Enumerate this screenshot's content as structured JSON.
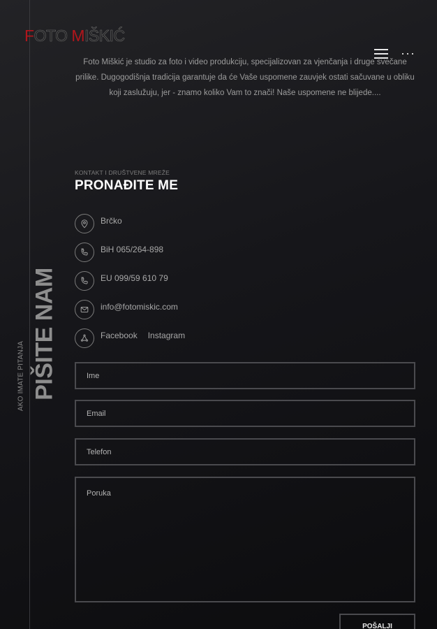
{
  "header": {
    "logo": {
      "part1_initial": "F",
      "part1_rest": "OTO",
      "part2_initial": "M",
      "part2_rest": "IŠKIĆ"
    },
    "menu_icon": "hamburger-icon",
    "more_icon": "ellipsis-icon",
    "more_glyph": "···"
  },
  "intro": {
    "text": "Foto Miškić je studio za foto i video produkciju, specijalizovan za vjenčanja i druge svečane prilike. Dugogodišnja tradicija garantuje da će Vaše uspomene zauvjek ostati sačuvane u obliku koji zaslužuju, jer - znamo koliko Vam to znači! Naše uspomene ne blijede...."
  },
  "contact": {
    "kicker": "KONTAKT I DRUŠTVENE MREŽE",
    "heading": "PRONAĐITE ME",
    "items": [
      {
        "icon": "location-pin-icon",
        "text": "Brčko"
      },
      {
        "icon": "phone-icon",
        "text": "BiH 065/264-898"
      },
      {
        "icon": "phone-icon",
        "text": "EU 099/59 610 79"
      },
      {
        "icon": "mail-icon",
        "text": "info@fotomiskic.com"
      }
    ],
    "social": {
      "icon": "share-icon",
      "facebook": "Facebook",
      "instagram": "Instagram"
    }
  },
  "side": {
    "big": "PIŠITE NAM",
    "small": "AKO IMATE PITANJA"
  },
  "form": {
    "name_placeholder": "Ime",
    "email_placeholder": "Email",
    "phone_placeholder": "Telefon",
    "message_placeholder": "Poruka",
    "submit_label": "POŠALJI"
  },
  "colors": {
    "accent": "#b0161c",
    "background": "#16161a",
    "border": "#4a4a4e"
  }
}
